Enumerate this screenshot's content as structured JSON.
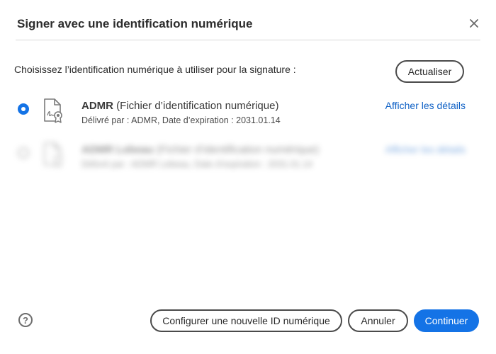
{
  "dialog": {
    "title": "Signer avec une identification numérique",
    "close_icon": "close-icon"
  },
  "prompt": "Choisissez l’identification numérique à utiliser pour la signature :",
  "refresh_label": "Actualiser",
  "identities": [
    {
      "selected": true,
      "icon": "certificate-icon",
      "name": "ADMR",
      "type": "(Fichier d’identification numérique)",
      "issuer": "Délivré par : ADMR, Date d’expiration : 2031.01.14",
      "details_label": "Afficher les détails"
    },
    {
      "selected": false,
      "blurred": true,
      "icon": "certificate-icon",
      "name": "ADMR Lebeau",
      "type": "(Fichier d’identification numérique)",
      "issuer": "Délivré par : ADMR Lebeau, Date d’expiration : 2031.01.14",
      "details_label": "Afficher les détails"
    }
  ],
  "footer": {
    "help_icon": "help-icon",
    "help_glyph": "?",
    "configure_label": "Configurer une nouvelle ID numérique",
    "cancel_label": "Annuler",
    "continue_label": "Continuer"
  },
  "colors": {
    "accent": "#1473e6",
    "link": "#1162c6",
    "border": "#4a4a4a"
  }
}
